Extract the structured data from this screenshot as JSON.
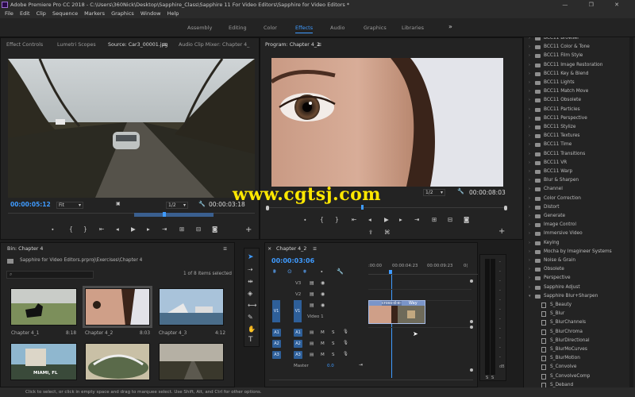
{
  "window": {
    "title": "Adobe Premiere Pro CC 2018 - C:\\Users\\360Nick\\Desktop\\Sapphire_Class\\Sapphire 11 For Video Editors\\Sapphire for Video Editors *",
    "controls": "— ❐ ✕"
  },
  "menu": [
    "File",
    "Edit",
    "Clip",
    "Sequence",
    "Markers",
    "Graphics",
    "Window",
    "Help"
  ],
  "workspaces": [
    "Assembly",
    "Editing",
    "Color",
    "Effects",
    "Audio",
    "Graphics",
    "Libraries"
  ],
  "workspaces_active": "Effects",
  "workspaces_more": "»",
  "source_panel": {
    "tabs": [
      "Effect Controls",
      "Lumetri Scopes",
      "Source: Car3_00001.jpg",
      "Audio Clip Mixer: Chapter 4_"
    ],
    "tab_menu": "≡",
    "timecode": "00:00:05:12",
    "fit": "Fit",
    "resolution": "1/2",
    "duration": "00:00:03:18"
  },
  "program_panel": {
    "title": "Program: Chapter 4_2",
    "tab_menu": "≡",
    "resolution": "1/2",
    "duration": "00:00:08:03"
  },
  "watermark": "www.cgtsj.com",
  "project": {
    "tab": "Bin: Chapter 4",
    "path": "Sapphire for Video Editors.prproj\\Exercises\\Chapter 4",
    "count": "1 of 8 items selected",
    "clips": [
      {
        "name": "Chapter 4_1",
        "dur": "8:18"
      },
      {
        "name": "Chapter 4_2",
        "dur": "8:03"
      },
      {
        "name": "Chapter 4_3",
        "dur": "4:12"
      },
      {
        "name": "",
        "dur": ""
      },
      {
        "name": "",
        "dur": ""
      },
      {
        "name": "",
        "dur": ""
      }
    ],
    "thumb4_text": "MIAMI, FL"
  },
  "timeline": {
    "tab": "Chapter 4_2",
    "timecode": "00:00:03:06",
    "ruler": [
      ":00:00",
      "00:00:04:23",
      "00:00:09:23",
      "0("
    ],
    "tracks": {
      "video": [
        "V3",
        "V2",
        "V1"
      ],
      "audio": [
        "A1",
        "A2",
        "A3"
      ],
      "video_label": "Video 1",
      "master": "Master",
      "master_val": "0.0"
    },
    "clip_a": "cross-d-e-",
    "clip_b": "Way"
  },
  "meter_db": [
    "-",
    "-",
    "-",
    "-",
    "-",
    "-",
    "-",
    "-",
    "-",
    "-",
    "-",
    "dB"
  ],
  "meter_solo": [
    "S",
    "S"
  ],
  "effects": [
    {
      "label": "BCC11 Browser",
      "kind": "folder"
    },
    {
      "label": "BCC11 Color & Tone",
      "kind": "folder"
    },
    {
      "label": "BCC11 Film Style",
      "kind": "folder"
    },
    {
      "label": "BCC11 Image Restoration",
      "kind": "folder"
    },
    {
      "label": "BCC11 Key & Blend",
      "kind": "folder"
    },
    {
      "label": "BCC11 Lights",
      "kind": "folder"
    },
    {
      "label": "BCC11 Match Move",
      "kind": "folder"
    },
    {
      "label": "BCC11 Obsolete",
      "kind": "folder"
    },
    {
      "label": "BCC11 Particles",
      "kind": "folder"
    },
    {
      "label": "BCC11 Perspective",
      "kind": "folder"
    },
    {
      "label": "BCC11 Stylize",
      "kind": "folder"
    },
    {
      "label": "BCC11 Textures",
      "kind": "folder"
    },
    {
      "label": "BCC11 Time",
      "kind": "folder"
    },
    {
      "label": "BCC11 Transitions",
      "kind": "folder"
    },
    {
      "label": "BCC11 VR",
      "kind": "folder"
    },
    {
      "label": "BCC11 Warp",
      "kind": "folder"
    },
    {
      "label": "Blur & Sharpen",
      "kind": "folder"
    },
    {
      "label": "Channel",
      "kind": "folder"
    },
    {
      "label": "Color Correction",
      "kind": "folder"
    },
    {
      "label": "Distort",
      "kind": "folder"
    },
    {
      "label": "Generate",
      "kind": "folder"
    },
    {
      "label": "Image Control",
      "kind": "folder"
    },
    {
      "label": "Immersive Video",
      "kind": "folder"
    },
    {
      "label": "Keying",
      "kind": "folder"
    },
    {
      "label": "Mocha by Imagineer Systems",
      "kind": "folder"
    },
    {
      "label": "Noise & Grain",
      "kind": "folder"
    },
    {
      "label": "Obsolete",
      "kind": "folder"
    },
    {
      "label": "Perspective",
      "kind": "folder"
    },
    {
      "label": "Sapphire Adjust",
      "kind": "folder"
    },
    {
      "label": "Sapphire Blur+Sharpen",
      "kind": "open"
    },
    {
      "label": "S_Beauty",
      "kind": "item"
    },
    {
      "label": "S_Blur",
      "kind": "item"
    },
    {
      "label": "S_BlurChannels",
      "kind": "item"
    },
    {
      "label": "S_BlurChroma",
      "kind": "item"
    },
    {
      "label": "S_BlurDirectional",
      "kind": "item"
    },
    {
      "label": "S_BlurMoCurves",
      "kind": "item"
    },
    {
      "label": "S_BlurMotion",
      "kind": "item"
    },
    {
      "label": "S_Convolve",
      "kind": "item"
    },
    {
      "label": "S_ConvolveComp",
      "kind": "item"
    },
    {
      "label": "S_Deband",
      "kind": "item"
    }
  ],
  "status": "Click to select, or click in empty space and drag to marquee select. Use Shift, Alt, and Ctrl for other options.",
  "colors": {
    "accent": "#3f9bff",
    "watermark": "#ffe800",
    "track_button": "#2e5f99",
    "clip": "#7a95c9"
  },
  "icons": {
    "transport": [
      "add-marker-icon",
      "mark-in-icon",
      "mark-out-icon",
      "go-to-in-icon",
      "step-back-icon",
      "play-icon",
      "step-forward-icon",
      "go-to-out-icon",
      "insert-icon",
      "overwrite-icon",
      "export-frame-icon",
      "add-button-icon"
    ],
    "timeline_tools": [
      "selection-tool-icon",
      "track-select-icon",
      "ripple-edit-icon",
      "razor-tool-icon",
      "slip-tool-icon",
      "pen-tool-icon",
      "hand-tool-icon",
      "type-tool-icon"
    ]
  }
}
